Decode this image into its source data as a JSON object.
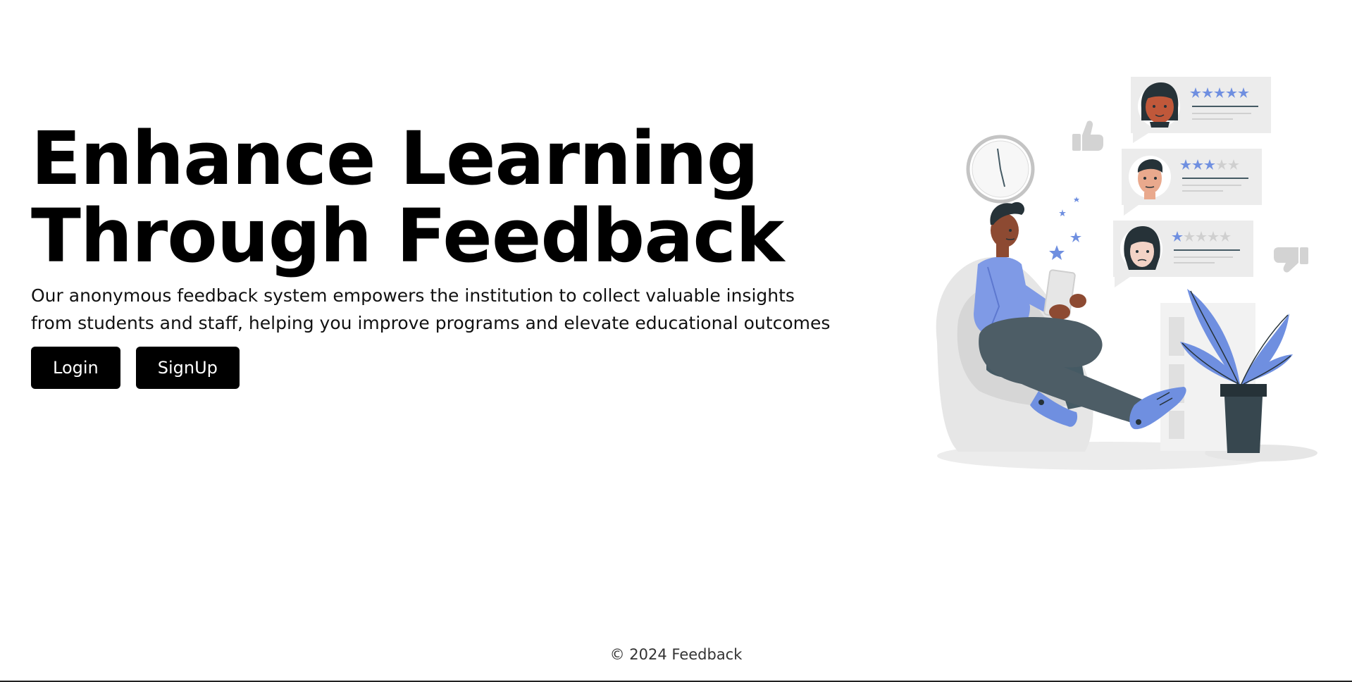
{
  "hero": {
    "title_line1": "Enhance Learning",
    "title_line2": "Through Feedback",
    "description": "Our anonymous feedback system empowers the institution to collect valuable insights from students and staff, helping you improve programs and elevate educational outcomes"
  },
  "buttons": {
    "login_label": "Login",
    "signup_label": "SignUp"
  },
  "illustration": {
    "icon": "feedback-illustration",
    "ratings": [
      5,
      3,
      1
    ],
    "colors": {
      "accent": "#6f8fe0",
      "dark": "#455a64",
      "light_gray": "#e0e0e0",
      "skin": "#8d4a32"
    }
  },
  "footer": {
    "copyright": "© 2024 Feedback"
  }
}
